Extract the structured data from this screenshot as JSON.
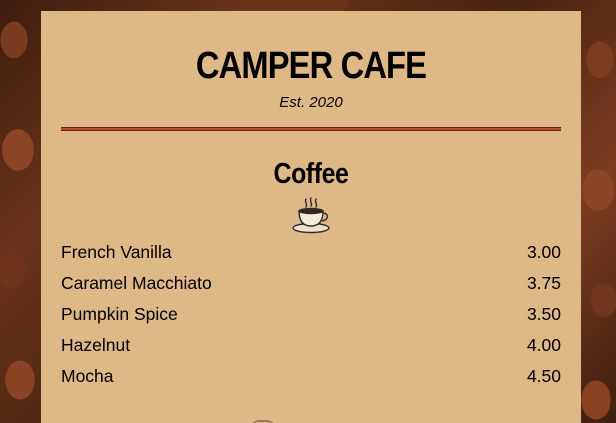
{
  "header": {
    "cafe_name": "CAMPER CAFE",
    "established": "Est. 2020"
  },
  "coffee_section": {
    "title": "Coffee",
    "icon": "coffee-cup-icon",
    "items": [
      {
        "flavor": "French Vanilla",
        "price": "3.00"
      },
      {
        "flavor": "Caramel Macchiato",
        "price": "3.75"
      },
      {
        "flavor": "Pumpkin Spice",
        "price": "3.50"
      },
      {
        "flavor": "Hazelnut",
        "price": "4.00"
      },
      {
        "flavor": "Mocha",
        "price": "4.50"
      }
    ]
  },
  "colors": {
    "menu_background": "#deb887",
    "divider": "#b8492d",
    "text": "#000000"
  }
}
